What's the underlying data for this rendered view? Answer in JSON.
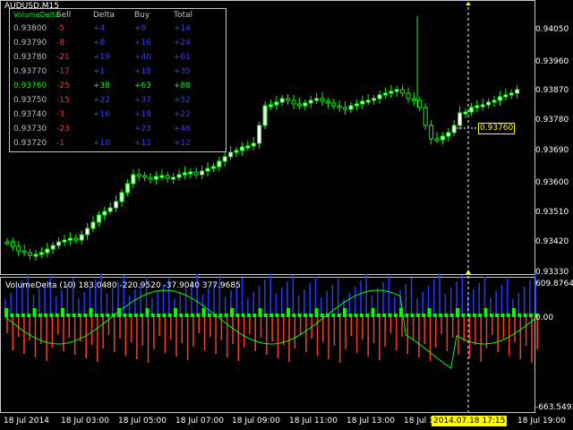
{
  "window": {
    "symbol_label": "AUDUSD,M15"
  },
  "colors": {
    "background": "#000000",
    "bull_candle": "#ffffff",
    "bear_candle": "#000000",
    "wick": "#00ff00",
    "crosshair": "#ffffff",
    "tag": "#ffff00",
    "buy": "#1e3cff",
    "sell": "#ff3c1e",
    "delta": "#00ff00"
  },
  "table": {
    "title": "VolumeDelta",
    "headers": [
      "Sell",
      "Delta",
      "Buy",
      "Total"
    ],
    "rows": [
      {
        "price": "0.93800",
        "sell": "-5",
        "delta": "+4",
        "buy": "+9",
        "total": "+14",
        "highlight": false
      },
      {
        "price": "0.93790",
        "sell": "-8",
        "delta": "+8",
        "buy": "+16",
        "total": "+24",
        "highlight": false
      },
      {
        "price": "0.93780",
        "sell": "-21",
        "delta": "+19",
        "buy": "+40",
        "total": "+61",
        "highlight": false
      },
      {
        "price": "0.93770",
        "sell": "-17",
        "delta": "+1",
        "buy": "+18",
        "total": "+35",
        "highlight": false
      },
      {
        "price": "0.93760",
        "sell": "-25",
        "delta": "+38",
        "buy": "+63",
        "total": "+88",
        "highlight": true
      },
      {
        "price": "0.93750",
        "sell": "-15",
        "delta": "+22",
        "buy": "+37",
        "total": "+52",
        "highlight": false
      },
      {
        "price": "0.93740",
        "sell": "-3",
        "delta": "+16",
        "buy": "+19",
        "total": "+22",
        "highlight": false
      },
      {
        "price": "0.93730",
        "sell": "-23",
        "delta": "",
        "buy": "+23",
        "total": "+46",
        "highlight": false
      },
      {
        "price": "0.93720",
        "sell": "-1",
        "delta": "+10",
        "buy": "+11",
        "total": "+12",
        "highlight": false
      }
    ]
  },
  "price_axis": {
    "labels": [
      "0.94050",
      "0.93960",
      "0.93870",
      "0.93780",
      "0.93690",
      "0.93600",
      "0.93510",
      "0.93420",
      "0.93330"
    ],
    "current_price": "0.93760"
  },
  "indicator": {
    "header": "VolumeDelta (10) 183.0480 -220.9520 -37.9040 377.9685",
    "axis_labels": [
      "609.8764",
      "0.00",
      "-663.5493"
    ]
  },
  "time_axis": {
    "labels": [
      "18 Jul 2014",
      "18 Jul 03:00",
      "18 Jul 05:00",
      "18 Jul 07:00",
      "18 Jul 09:00",
      "18 Jul 11:00",
      "18 Jul 13:00",
      "18 Jul 15"
    ],
    "crosshair_time": "2014.07.18 17:15",
    "last_label": "18 Jul 19:00"
  }
}
